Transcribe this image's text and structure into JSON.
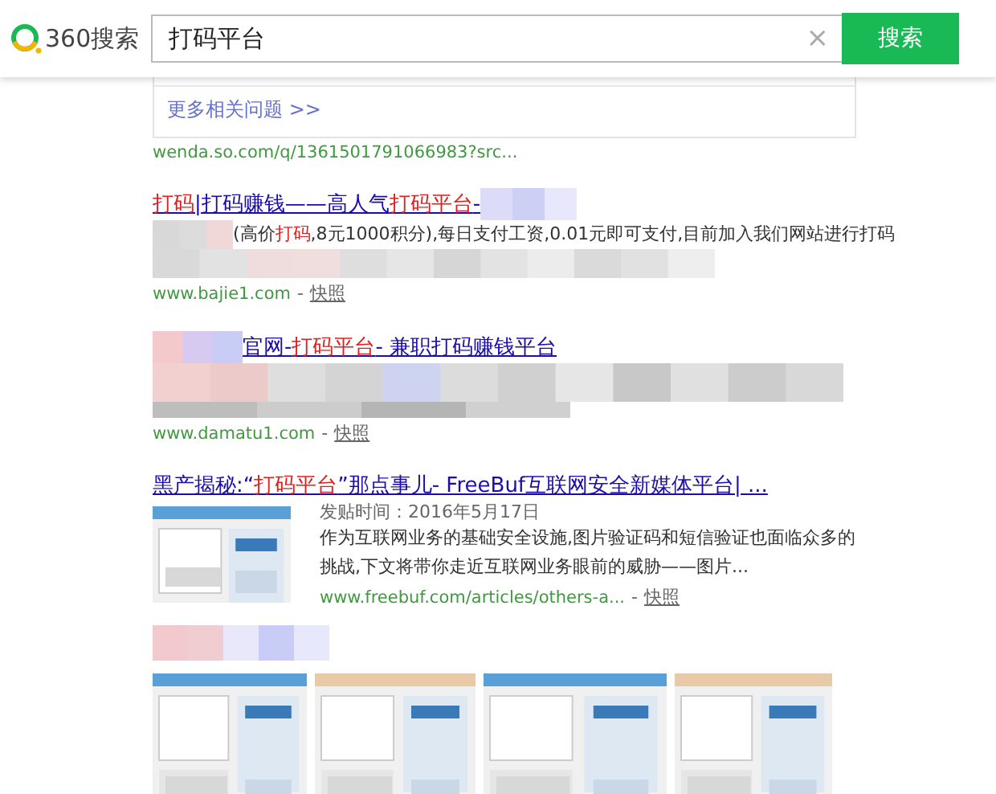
{
  "header": {
    "logo_text": "360搜索",
    "query": "打码平台",
    "clear_icon": "×",
    "search_button": "搜索"
  },
  "related": {
    "more_link": "更多相关问题 >>",
    "url": "wenda.so.com/q/1361501791066983?src..."
  },
  "results": [
    {
      "title": [
        {
          "text": "打码",
          "highlight": true
        },
        {
          "text": "|打码赚钱——高人气",
          "highlight": false
        },
        {
          "text": "打码平台",
          "highlight": true
        },
        {
          "text": "-",
          "highlight": false
        }
      ],
      "snippet": [
        {
          "text": "(高价",
          "highlight": false
        },
        {
          "text": "打码",
          "highlight": true
        },
        {
          "text": ",8元1000积分),每日支付工资,0.01元即可支付,目前加入我们网站进行打码",
          "highlight": false
        }
      ],
      "url": "www.bajie1.com",
      "snapshot": "快照",
      "kind": "text"
    },
    {
      "title": [
        {
          "text": "官网-",
          "highlight": false
        },
        {
          "text": "打码平台",
          "highlight": true
        },
        {
          "text": "- 兼职打码赚钱平台",
          "highlight": false
        }
      ],
      "url": "www.damatu1.com",
      "snapshot": "快照",
      "kind": "blurred"
    },
    {
      "title": [
        {
          "text": "黑产揭秘:“",
          "highlight": false
        },
        {
          "text": "打码平台",
          "highlight": true
        },
        {
          "text": "”那点事儿- FreeBuf互联网安全新媒体平台| ...",
          "highlight": false
        }
      ],
      "date": "发贴时间：2016年5月17日",
      "snippet": [
        {
          "text": "作为互联网业务的基础安全设施,图片验证码和短信验证也面临众多的挑战,下文将带你走近互联网业务眼前的威胁——图片...",
          "highlight": false
        }
      ],
      "url": "www.freebuf.com/articles/others-a...",
      "snapshot": "快照",
      "kind": "thumbnail"
    }
  ],
  "separator": "-"
}
